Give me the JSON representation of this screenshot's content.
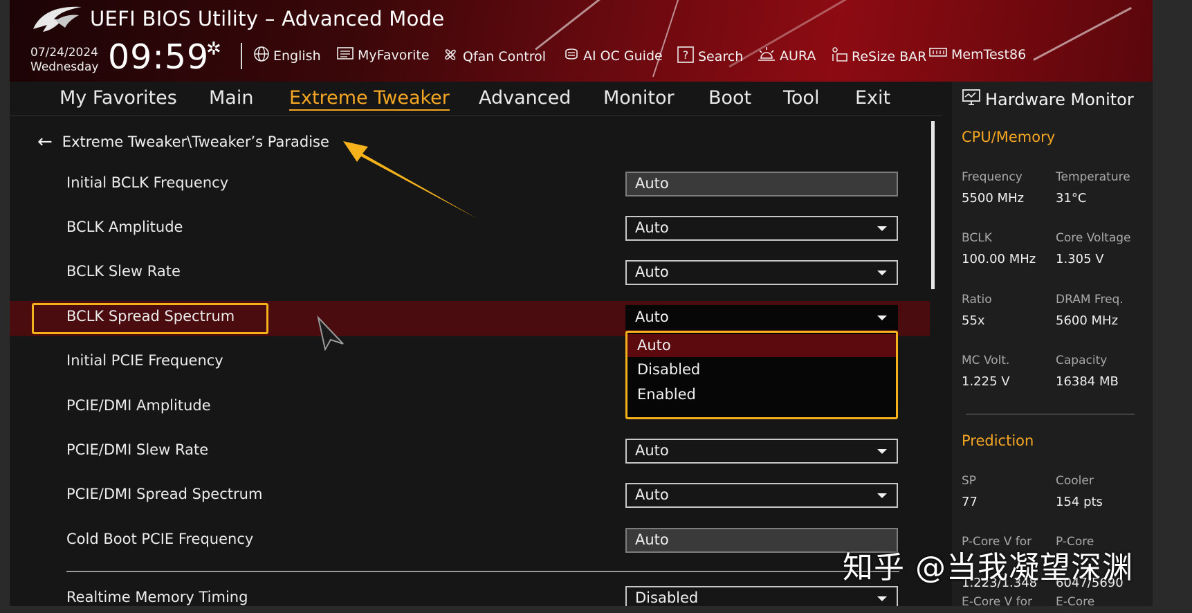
{
  "header": {
    "title": "UEFI BIOS Utility – Advanced Mode",
    "date": "07/24/2024",
    "weekday": "Wednesday",
    "time": "09:59",
    "tools": [
      {
        "label": "English",
        "icon": "globe-icon"
      },
      {
        "label": "MyFavorite",
        "icon": "favorite-list-icon"
      },
      {
        "label": "Qfan Control",
        "icon": "fan-icon"
      },
      {
        "label": "AI OC Guide",
        "icon": "chip-icon"
      },
      {
        "label": "Search",
        "icon": "search-question-icon"
      },
      {
        "label": "AURA",
        "icon": "aura-light-icon"
      },
      {
        "label": "ReSize BAR",
        "icon": "resize-bar-icon"
      },
      {
        "label": "MemTest86",
        "icon": "memory-icon"
      }
    ]
  },
  "nav": {
    "tabs": [
      "My Favorites",
      "Main",
      "Extreme Tweaker",
      "Advanced",
      "Monitor",
      "Boot",
      "Tool",
      "Exit"
    ],
    "active": "Extreme Tweaker"
  },
  "breadcrumb": "Extreme Tweaker\\Tweaker’s Paradise",
  "settings": [
    {
      "label": "Initial BCLK Frequency",
      "value": "Auto",
      "type": "readonly"
    },
    {
      "label": "BCLK Amplitude",
      "value": "Auto",
      "type": "dropdown"
    },
    {
      "label": "BCLK Slew Rate",
      "value": "Auto",
      "type": "dropdown"
    },
    {
      "label": "BCLK Spread Spectrum",
      "value": "Auto",
      "type": "dropdown"
    },
    {
      "label": "Initial PCIE Frequency",
      "value": "",
      "type": "hidden"
    },
    {
      "label": "PCIE/DMI Amplitude",
      "value": "",
      "type": "hidden"
    },
    {
      "label": "PCIE/DMI Slew Rate",
      "value": "Auto",
      "type": "dropdown"
    },
    {
      "label": "PCIE/DMI Spread Spectrum",
      "value": "Auto",
      "type": "dropdown"
    },
    {
      "label": "Cold Boot PCIE Frequency",
      "value": "Auto",
      "type": "readonly"
    },
    {
      "label": "Realtime Memory Timing",
      "value": "Disabled",
      "type": "dropdown"
    }
  ],
  "dropdown_open": {
    "options": [
      "Auto",
      "Disabled",
      "Enabled"
    ],
    "selected": "Auto"
  },
  "hardware_monitor": {
    "title": "Hardware Monitor",
    "cpu_memory": {
      "heading": "CPU/Memory",
      "items": [
        {
          "k": "Frequency",
          "v": "5500 MHz"
        },
        {
          "k": "Temperature",
          "v": "31°C"
        },
        {
          "k": "BCLK",
          "v": "100.00 MHz"
        },
        {
          "k": "Core Voltage",
          "v": "1.305 V"
        },
        {
          "k": "Ratio",
          "v": "55x"
        },
        {
          "k": "DRAM Freq.",
          "v": "5600 MHz"
        },
        {
          "k": "MC Volt.",
          "v": "1.225 V"
        },
        {
          "k": "Capacity",
          "v": "16384 MB"
        }
      ]
    },
    "prediction": {
      "heading": "Prediction",
      "items": [
        {
          "k": "SP",
          "v": "77"
        },
        {
          "k": "Cooler",
          "v": "154 pts"
        },
        {
          "k": "P-Core V for",
          "v": "1.223/1.348"
        },
        {
          "k": "P-Core",
          "v": "6047/5690"
        },
        {
          "k": "E-Core V for",
          "v": ""
        },
        {
          "k": "E-Core",
          "v": ""
        }
      ]
    }
  },
  "watermark": "知乎 @当我凝望深渊",
  "colors": {
    "accent": "#f5a623",
    "highlight_row": "#4a0c0e",
    "annotation": "#f5b21a"
  }
}
